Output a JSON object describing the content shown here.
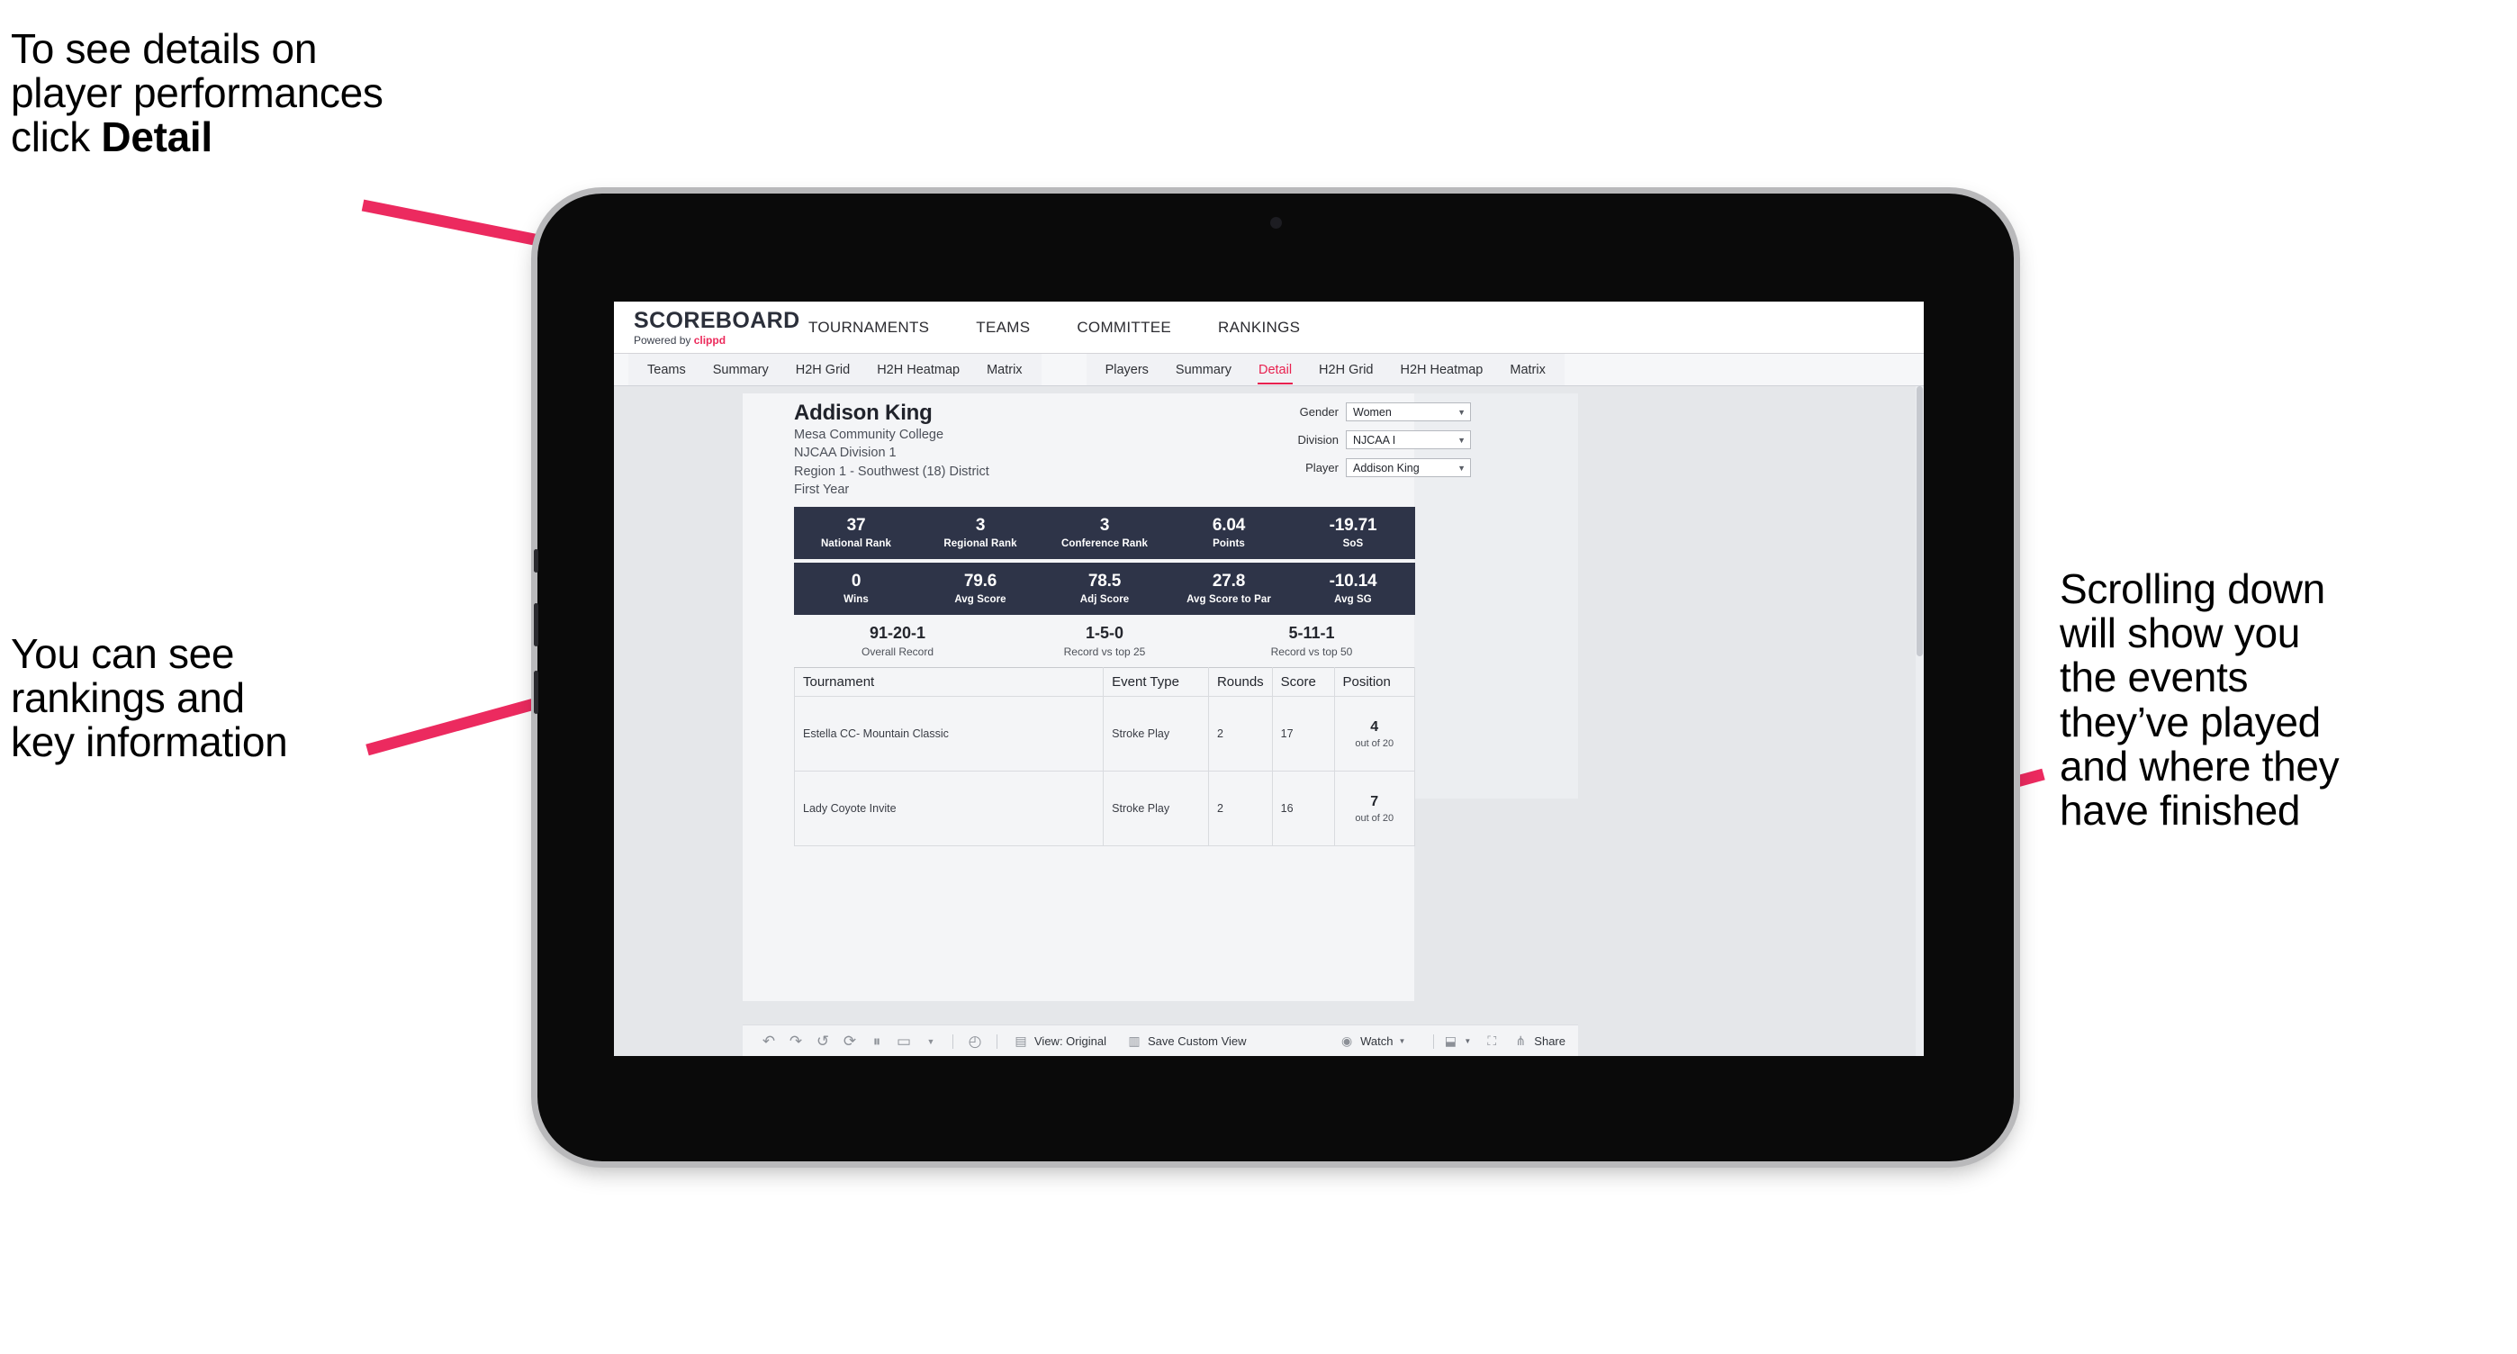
{
  "annotations": {
    "top_left": "To see details on\nplayer performances\nclick ",
    "top_left_bold": "Detail",
    "bottom_left": "You can see\nrankings and\nkey information",
    "right": "Scrolling down\nwill show you\nthe events\nthey’ve played\nand where they\nhave finished"
  },
  "brand": {
    "name": "SCOREBOARD",
    "powered_prefix": "Powered by ",
    "powered_by": "clippd"
  },
  "topnav": {
    "links": [
      "TOURNAMENTS",
      "TEAMS",
      "COMMITTEE",
      "RANKINGS"
    ]
  },
  "subnav": {
    "group_one": [
      "Teams",
      "Summary",
      "H2H Grid",
      "H2H Heatmap",
      "Matrix"
    ],
    "group_two": [
      "Players",
      "Summary",
      "Detail",
      "H2H Grid",
      "H2H Heatmap",
      "Matrix"
    ],
    "active": "Detail"
  },
  "player": {
    "name": "Addison King",
    "school": "Mesa Community College",
    "division": "NJCAA Division 1",
    "region": "Region 1 - Southwest (18) District",
    "year": "First Year"
  },
  "filters": [
    {
      "label": "Gender",
      "value": "Women"
    },
    {
      "label": "Division",
      "value": "NJCAA I"
    },
    {
      "label": "Player",
      "value": "Addison King"
    }
  ],
  "stats_row_one": [
    {
      "value": "37",
      "label": "National Rank"
    },
    {
      "value": "3",
      "label": "Regional Rank"
    },
    {
      "value": "3",
      "label": "Conference Rank"
    },
    {
      "value": "6.04",
      "label": "Points"
    },
    {
      "value": "-19.71",
      "label": "SoS"
    }
  ],
  "stats_row_two": [
    {
      "value": "0",
      "label": "Wins"
    },
    {
      "value": "79.6",
      "label": "Avg Score"
    },
    {
      "value": "78.5",
      "label": "Adj Score"
    },
    {
      "value": "27.8",
      "label": "Avg Score to Par"
    },
    {
      "value": "-10.14",
      "label": "Avg SG"
    }
  ],
  "records": [
    {
      "value": "91-20-1",
      "label": "Overall Record"
    },
    {
      "value": "1-5-0",
      "label": "Record vs top 25"
    },
    {
      "value": "5-11-1",
      "label": "Record vs top 50"
    }
  ],
  "events_table": {
    "headers": [
      "Tournament",
      "Event Type",
      "Rounds",
      "Score",
      "Position"
    ],
    "rows": [
      {
        "tournament": "Estella CC- Mountain Classic",
        "event_type": "Stroke Play",
        "rounds": "2",
        "score": "17",
        "position": "4",
        "position_sub": "out of 20"
      },
      {
        "tournament": "Lady Coyote Invite",
        "event_type": "Stroke Play",
        "rounds": "2",
        "score": "16",
        "position": "7",
        "position_sub": "out of 20"
      }
    ]
  },
  "toolbar": {
    "view_label": "View: Original",
    "save_label": "Save Custom View",
    "watch_label": "Watch",
    "share_label": "Share"
  },
  "colors": {
    "accent_pink": "#e8214f",
    "arrow_pink": "#ec2a5f",
    "stat_bar_navy": "#2e3448"
  }
}
